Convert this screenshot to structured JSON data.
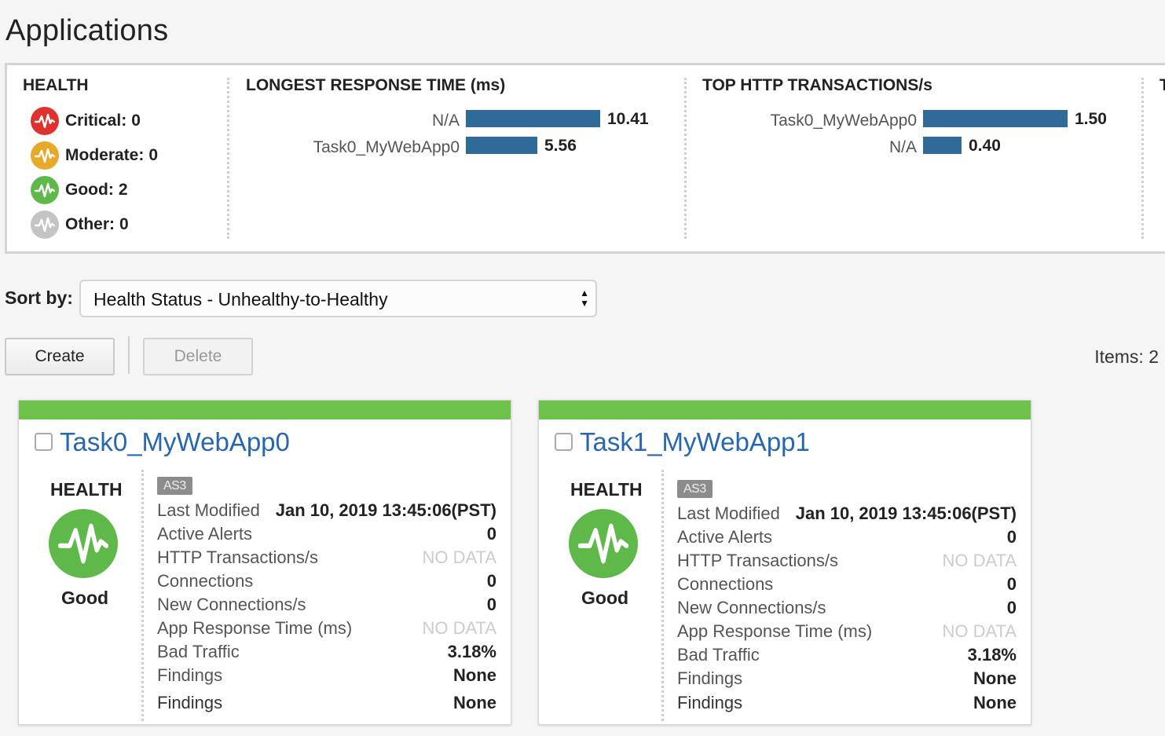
{
  "page": {
    "title": "Applications"
  },
  "summary": {
    "health": {
      "title": "HEALTH",
      "items": [
        {
          "label": "Critical:",
          "count": "0",
          "color": "#e0312c",
          "icon": "critical-pulse-icon"
        },
        {
          "label": "Moderate:",
          "count": "0",
          "color": "#e8a828",
          "icon": "moderate-pulse-icon"
        },
        {
          "label": "Good:",
          "count": "2",
          "color": "#5fb84a",
          "icon": "good-pulse-icon"
        },
        {
          "label": "Other:",
          "count": "0",
          "color": "#c4c4c4",
          "icon": "other-pulse-icon"
        }
      ]
    },
    "response_time": {
      "title": "LONGEST RESPONSE TIME (ms)",
      "rows": [
        {
          "label": "N/A",
          "value": "10.41",
          "fraction": 1.0
        },
        {
          "label": "Task0_MyWebApp0",
          "value": "5.56",
          "fraction": 0.534
        }
      ]
    },
    "http_tx": {
      "title": "TOP HTTP TRANSACTIONS/s",
      "rows": [
        {
          "label": "Task0_MyWebApp0",
          "value": "1.50",
          "fraction": 1.0
        },
        {
          "label": "N/A",
          "value": "0.40",
          "fraction": 0.267
        }
      ]
    },
    "partial_next_title": "T"
  },
  "sort": {
    "label": "Sort by:",
    "value": "Health Status - Unhealthy-to-Healthy"
  },
  "toolbar": {
    "create_label": "Create",
    "delete_label": "Delete",
    "items_count": "Items: 2"
  },
  "cards": [
    {
      "name": "Task0_MyWebApp0",
      "health_title": "HEALTH",
      "health_status": "Good",
      "badge": "AS3",
      "metrics": [
        {
          "key": "Last Modified",
          "value": "Jan 10, 2019 13:45:06(PST)"
        },
        {
          "key": "Active Alerts",
          "value": "0"
        },
        {
          "key": "HTTP Transactions/s",
          "value": "NO DATA"
        },
        {
          "key": "Connections",
          "value": "0"
        },
        {
          "key": "New Connections/s",
          "value": "0"
        },
        {
          "key": "App Response Time (ms)",
          "value": "NO DATA"
        },
        {
          "key": "Bad Traffic",
          "value": "3.18%"
        },
        {
          "key": "Findings",
          "value": "None"
        },
        {
          "key": "Findings",
          "value": "None"
        }
      ]
    },
    {
      "name": "Task1_MyWebApp1",
      "health_title": "HEALTH",
      "health_status": "Good",
      "badge": "AS3",
      "metrics": [
        {
          "key": "Last Modified",
          "value": "Jan 10, 2019 13:45:06(PST)"
        },
        {
          "key": "Active Alerts",
          "value": "0"
        },
        {
          "key": "HTTP Transactions/s",
          "value": "NO DATA"
        },
        {
          "key": "Connections",
          "value": "0"
        },
        {
          "key": "New Connections/s",
          "value": "0"
        },
        {
          "key": "App Response Time (ms)",
          "value": "NO DATA"
        },
        {
          "key": "Bad Traffic",
          "value": "3.18%"
        },
        {
          "key": "Findings",
          "value": "None"
        },
        {
          "key": "Findings",
          "value": "None"
        }
      ]
    }
  ]
}
